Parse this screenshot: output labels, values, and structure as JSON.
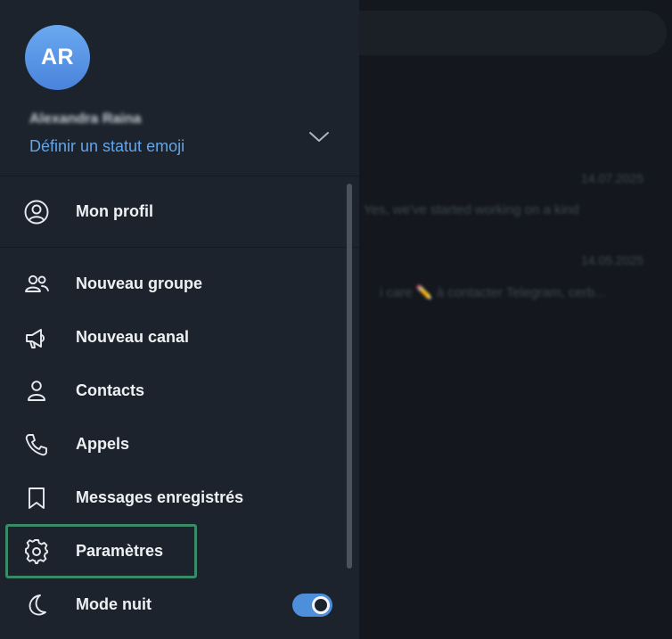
{
  "background_chat": {
    "dates": [
      "14.07.2025",
      "14.05.2025"
    ],
    "snippets": [
      "Yes, we've started working on a kind",
      "i care ✏️ à contacter Telegram, cerb..."
    ]
  },
  "profile": {
    "avatar_initials": "AR",
    "name": "Alexandra Raina",
    "emoji_status_link": "Définir un statut emoji"
  },
  "menu": {
    "profile": "Mon profil",
    "items": [
      {
        "label": "Nouveau groupe",
        "icon": "group-icon"
      },
      {
        "label": "Nouveau canal",
        "icon": "megaphone-icon"
      },
      {
        "label": "Contacts",
        "icon": "person-icon"
      },
      {
        "label": "Appels",
        "icon": "phone-icon"
      },
      {
        "label": "Messages enregistrés",
        "icon": "bookmark-icon"
      },
      {
        "label": "Paramètres",
        "icon": "gear-icon"
      },
      {
        "label": "Mode nuit",
        "icon": "moon-icon"
      }
    ],
    "night_mode_on": true
  },
  "colors": {
    "accent": "#63a5e8",
    "highlight_border": "#3a8a68",
    "drawer_bg": "#1c232c"
  }
}
